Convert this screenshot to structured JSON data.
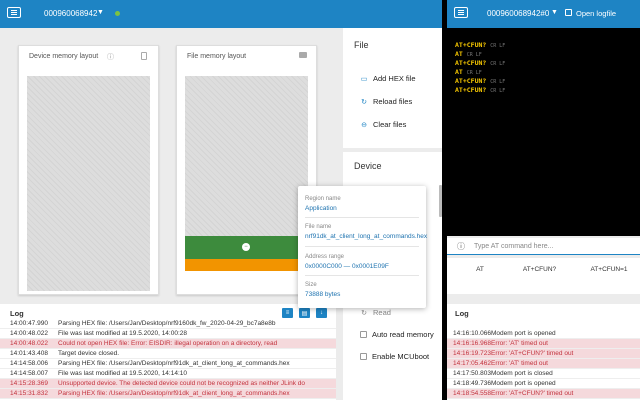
{
  "left": {
    "device_serial": "000960068942",
    "memory": {
      "device_title": "Device memory layout",
      "file_title": "File memory layout"
    },
    "file_panel": {
      "title": "File",
      "add_hex": "Add HEX file",
      "reload": "Reload files",
      "clear": "Clear files"
    },
    "device_panel": {
      "title": "Device",
      "read": "Read",
      "auto_read": "Auto read memory",
      "enable_mcuboot": "Enable MCUboot"
    },
    "tooltip": {
      "region_label": "Region name",
      "region_value": "Application",
      "file_label": "File name",
      "file_value": "nrf91dk_at_client_long_at_commands.hex",
      "range_label": "Address range",
      "range_value": "0x0000C000 — 0x0001E09F",
      "size_label": "Size",
      "size_value": "73888 bytes"
    },
    "log": {
      "title": "Log",
      "rows": [
        {
          "time": "14:00:47.990",
          "msg": "Parsing HEX file: /Users/Jan/Desktop/nrf9160dk_fw_2020-04-29_bc7a8e8b",
          "error": false
        },
        {
          "time": "14:00:48.022",
          "msg": "File was last modified at 19.5.2020, 14:00:28",
          "error": false
        },
        {
          "time": "14:00:48.022",
          "msg": "Could not open HEX file: Error: EISDIR: illegal operation on a directory, read",
          "error": true
        },
        {
          "time": "14:01:43.408",
          "msg": "Target device closed.",
          "error": false
        },
        {
          "time": "14:14:58.006",
          "msg": "Parsing HEX file: /Users/Jan/Desktop/nrf91dk_at_client_long_at_commands.hex",
          "error": false
        },
        {
          "time": "14:14:58.007",
          "msg": "File was last modified at 19.5.2020, 14:14:10",
          "error": false
        },
        {
          "time": "14:15:28.369",
          "msg": "Unsupported device. The detected device could not be recognized as neither JLink do",
          "error": true
        },
        {
          "time": "14:15:31.832",
          "msg": "Parsing HEX file: /Users/Jan/Desktop/nrf91dk_at_client_long_at_commands.hex",
          "error": true
        }
      ]
    }
  },
  "right": {
    "device_serial": "000960068942#0",
    "open_logfile": "Open logfile",
    "terminal": [
      {
        "cmd": "AT+CFUN?",
        "ctl": "CR LF"
      },
      {
        "cmd": "AT",
        "ctl": "CR LF"
      },
      {
        "cmd": "AT+CFUN?",
        "ctl": "CR LF"
      },
      {
        "cmd": "AT",
        "ctl": "CR LF"
      },
      {
        "cmd": "AT+CFUN?",
        "ctl": "CR LF"
      },
      {
        "cmd": "AT+CFUN?",
        "ctl": "CR LF"
      }
    ],
    "input_placeholder": "Type AT command here...",
    "quick_buttons": [
      "AT",
      "AT+CFUN?",
      "AT+CFUN=1"
    ],
    "log": {
      "title": "Log",
      "rows": [
        {
          "time": "14:16:10.066",
          "msg": "Modem port is opened",
          "error": false
        },
        {
          "time": "14:16:16.968",
          "msg": "Error: 'AT' timed out",
          "error": true
        },
        {
          "time": "14:16:19.723",
          "msg": "Error: 'AT+CFUN?' timed out",
          "error": true
        },
        {
          "time": "14:17:05.462",
          "msg": "Error: 'AT' timed out",
          "error": true
        },
        {
          "time": "14:17:50.803",
          "msg": "Modem port is closed",
          "error": false
        },
        {
          "time": "14:18:49.736",
          "msg": "Modem port is opened",
          "error": false
        },
        {
          "time": "14:18:54.558",
          "msg": "Error: 'AT+CFUN?' timed out",
          "error": true
        }
      ]
    }
  },
  "colors": {
    "topbar": "#1e84c4",
    "region_green": "#3d8b3d",
    "region_orange": "#f29400",
    "error_bg": "#f5d9dc",
    "terminal_text": "#f7c800"
  }
}
